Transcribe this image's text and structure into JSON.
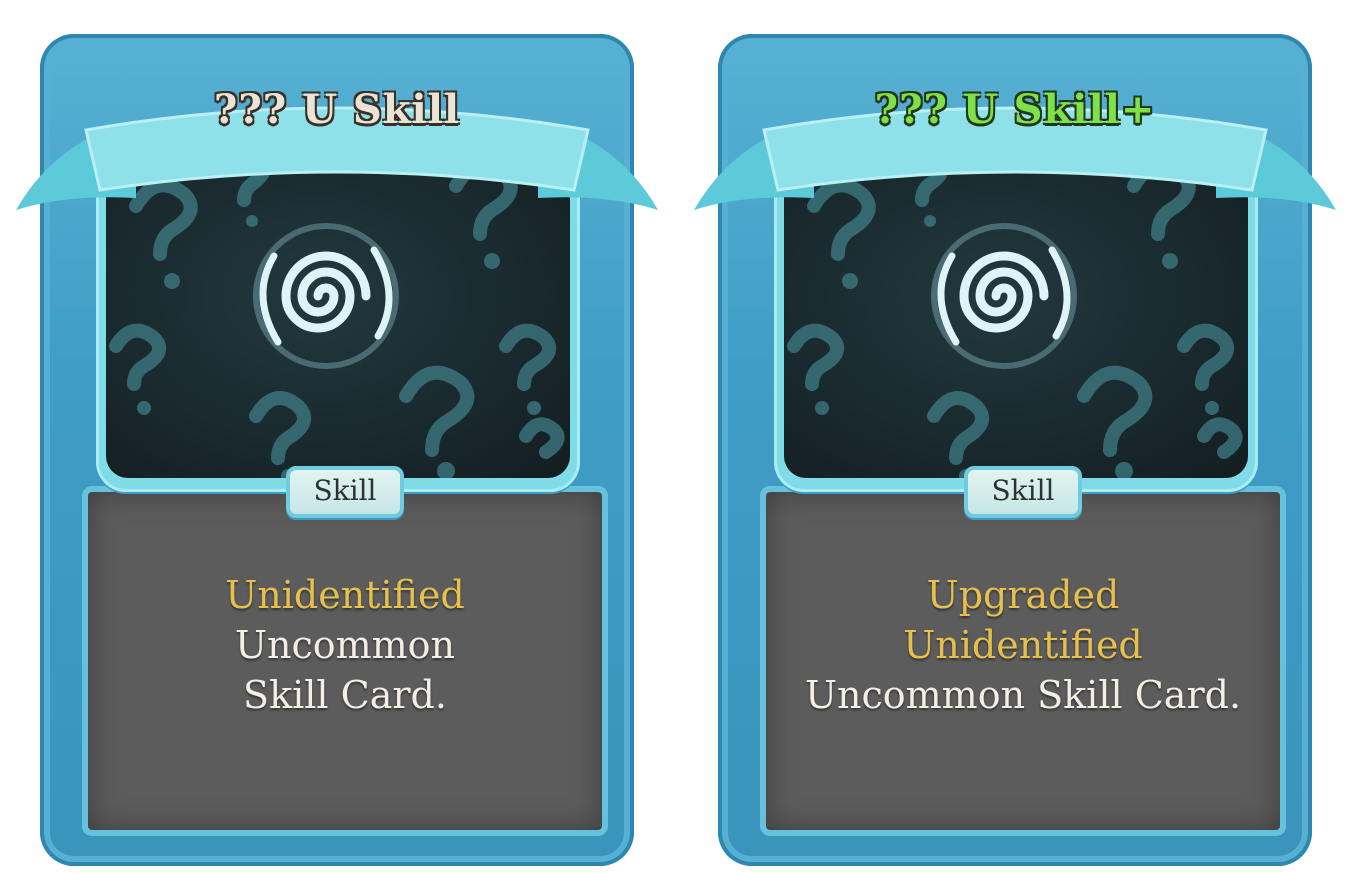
{
  "cards": {
    "left": {
      "title": "??? U Skill",
      "type": "Skill",
      "desc_keyword": "Unidentified",
      "desc_line1": "Uncommon",
      "desc_line2": "Skill Card."
    },
    "right": {
      "title": "??? U Skill+",
      "type": "Skill",
      "desc_keyword1": "Upgraded",
      "desc_keyword2": "Unidentified",
      "desc_line1": "Uncommon Skill Card."
    }
  },
  "colors": {
    "frame": "#3f9ec6",
    "banner": "#7fdbe6",
    "panel": "#5c5c5c",
    "keyword": "#e6c04a",
    "upgraded_title": "#7fe14a"
  },
  "icons": [
    "swirl-icon",
    "question-mark-pattern"
  ]
}
